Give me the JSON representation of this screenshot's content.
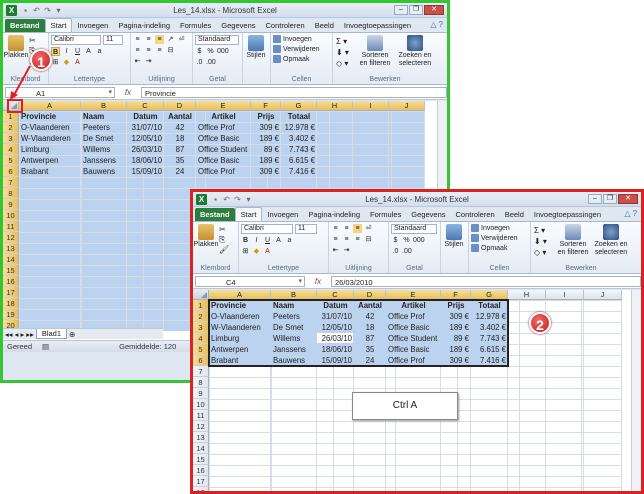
{
  "window1": {
    "title": "Les_14.xlsx  -  Microsoft Excel",
    "tabs": [
      "Bestand",
      "Start",
      "Invoegen",
      "Pagina-indeling",
      "Formules",
      "Gegevens",
      "Controleren",
      "Beeld",
      "Invoegtoepassingen"
    ],
    "name_box": "A1",
    "formula": "Provincie",
    "sheet_tab": "Blad1",
    "status_left": "Gereed",
    "status_mid": "Gemiddelde: 120",
    "badge": "1"
  },
  "window2": {
    "title": "Les_14.xlsx  -  Microsoft Excel",
    "tabs": [
      "Bestand",
      "Start",
      "Invoegen",
      "Pagina-indeling",
      "Formules",
      "Gegevens",
      "Controleren",
      "Beeld",
      "Invoegtoepassingen"
    ],
    "name_box": "C4",
    "formula": "26/03/2010",
    "badge": "2"
  },
  "ribbon": {
    "paste": "Plakken",
    "font_name": "Calibri",
    "font_size": "11",
    "number_format": "Standaard",
    "styles": "Stijlen",
    "insert": "Invoegen",
    "delete": "Verwijderen",
    "format": "Opmaak",
    "sort": "Sorteren en filteren",
    "find": "Zoeken en selecteren",
    "groups": {
      "clipboard": "Klembord",
      "font": "Lettertype",
      "alignment": "Uitlijning",
      "number": "Getal",
      "cells": "Cellen",
      "editing": "Bewerken"
    }
  },
  "columns": [
    "A",
    "B",
    "C",
    "D",
    "E",
    "F",
    "G",
    "H",
    "I",
    "J"
  ],
  "headers": [
    "Provincie",
    "Naam",
    "Datum",
    "Aantal",
    "Artikel",
    "Prijs",
    "Totaal"
  ],
  "rows": [
    [
      "O-Vlaanderen",
      "Peeters",
      "31/07/10",
      "42",
      "Office Prof",
      "309 €",
      "12.978 €"
    ],
    [
      "W-Vlaanderen",
      "De Smet",
      "12/05/10",
      "18",
      "Office Basic",
      "189 €",
      "3.402 €"
    ],
    [
      "Limburg",
      "Willems",
      "26/03/10",
      "87",
      "Office Student",
      "89 €",
      "7.743 €"
    ],
    [
      "Antwerpen",
      "Janssens",
      "18/06/10",
      "35",
      "Office Basic",
      "189 €",
      "6.615 €"
    ],
    [
      "Brabant",
      "Bauwens",
      "15/09/10",
      "24",
      "Office Prof",
      "309 €",
      "7.416 €"
    ]
  ],
  "callout": "Ctrl A",
  "colors": {
    "frame1": "#33c633",
    "frame2": "#dd2020",
    "selection": "#bcd3ef",
    "header_sel": "#e8bf5c"
  }
}
